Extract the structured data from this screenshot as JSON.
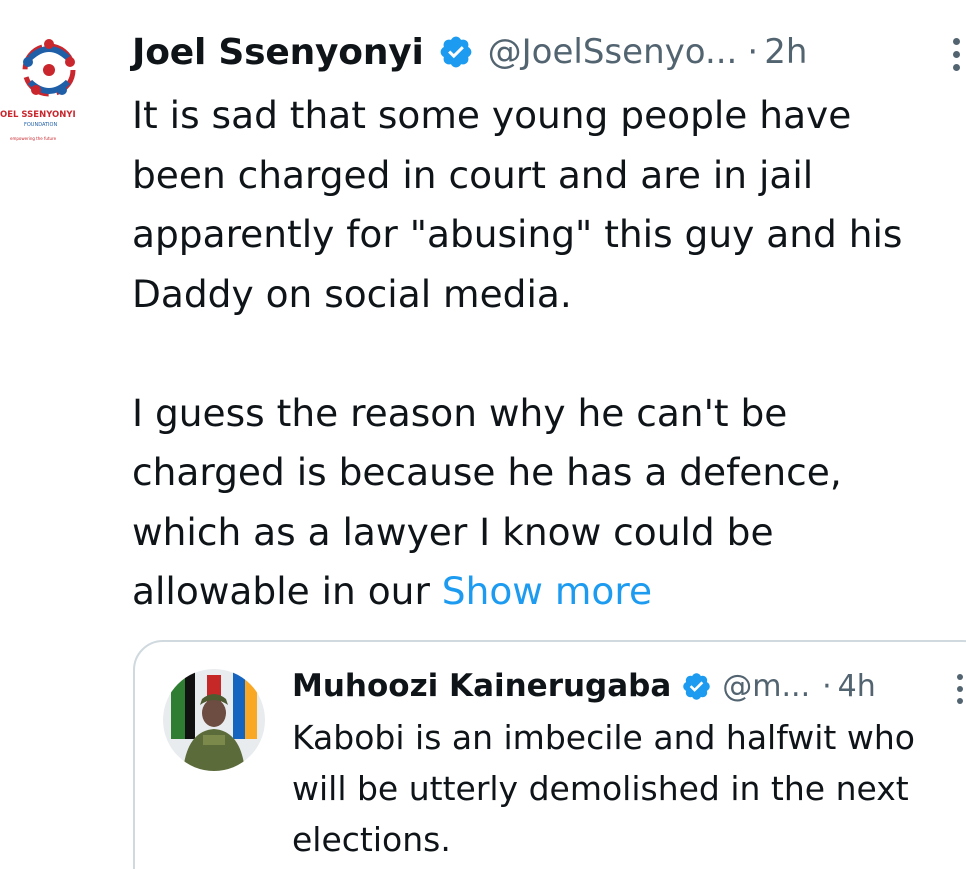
{
  "tweet": {
    "author_name": "Joel Ssenyonyi",
    "handle": "@JoelSsenyo...",
    "separator": "·",
    "time": "2h",
    "text_lines": [
      "It is sad that some young people have",
      "been charged in court and are in jail",
      "apparently for \"abusing\" this guy and his",
      "Daddy on social media.",
      "I guess the reason why he can't be",
      "charged is because he has a defence,",
      "which as a lawyer I know could be",
      "allowable in our "
    ],
    "show_more_label": "Show more",
    "avatar_logo": {
      "title": "OEL SSENYONYI",
      "subtitle": "FOUNDATION",
      "tagline": "empowering the future"
    }
  },
  "quoted_tweet": {
    "author_name": "Muhoozi Kainerugaba",
    "handle": "@m...",
    "separator": "·",
    "time": "4h",
    "text_lines": [
      "Kabobi is an imbecile and halfwit who",
      "will be utterly demolished in the next",
      "elections."
    ]
  },
  "icons": {
    "verified": "verified-badge-icon",
    "more": "more-options-icon"
  },
  "colors": {
    "text": "#0f1419",
    "secondary": "#536471",
    "link": "#1d9bf0",
    "verified": "#1d9bf0",
    "border": "#cfd9de"
  }
}
